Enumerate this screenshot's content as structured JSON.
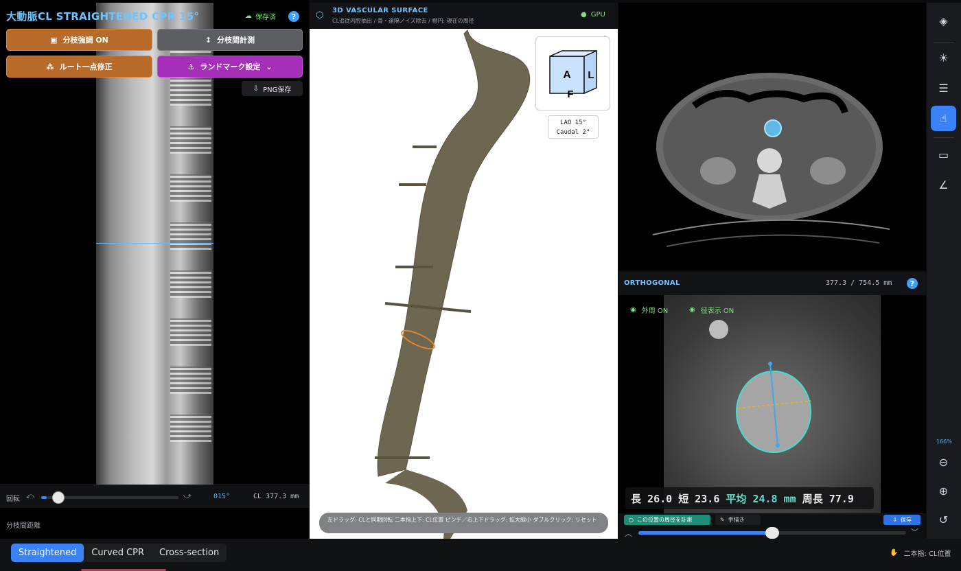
{
  "left": {
    "title": "大動脈CL  STRAIGHTENED CPR  15°",
    "saved_label": "保存済",
    "help": "?",
    "buttons": {
      "branch_emphasis": "分枝強調 ON",
      "branch_measure": "分枝間計測",
      "route_fix": "ルート一点修正",
      "landmark": "ランドマーク設定",
      "png_save": "PNG保存"
    },
    "rotation": {
      "label": "回転",
      "value_label": "015°",
      "cl_label": "CL 377.3 mm",
      "value_deg": 15
    },
    "branch_distance_label": "分枝間距離"
  },
  "center": {
    "title": "3D VASCULAR SURFACE",
    "subtitle": "CL追従内腔抽出 / 骨・遠隔ノイズ除去 / 橙円: 現在の周径",
    "gpu_label": "GPU",
    "cube": {
      "face_a": "A",
      "face_l": "L",
      "face_f": "F"
    },
    "view_line1": "LAO 15°",
    "view_line2": "Caudal 2°",
    "hint": "左ドラッグ: CLと同期回転  二本指上下: CL位置  ピンチ／右上下ドラッグ: 拡大縮小  ダブルクリック: リセット"
  },
  "ortho": {
    "title": "ORTHOGONAL",
    "position": "377.3 / 754.5 mm",
    "help": "?",
    "toggle_outer": "外周 ON",
    "toggle_diam": "径表示 ON",
    "measure": {
      "long_label": "長",
      "long": "26.0",
      "short_label": "短",
      "short": "23.6",
      "avg_label": "平均",
      "avg": "24.8 mm",
      "circ_label": "周長",
      "circ": "77.9"
    },
    "btn_measure": "この位置の周径を計測",
    "btn_draw": "手描き",
    "btn_save": "保存",
    "slider_fraction": 0.5
  },
  "toolbar": {
    "zoom": "166%"
  },
  "bottom": {
    "tabs": [
      "Straightened",
      "Curved CPR",
      "Cross-section"
    ],
    "two_finger": "二本指: CL位置"
  },
  "colors": {
    "accent": "#3b82f6",
    "title": "#6fc4ff",
    "ok": "#7ee07e",
    "orange": "#b76a2a",
    "purple": "#a52fb8"
  }
}
